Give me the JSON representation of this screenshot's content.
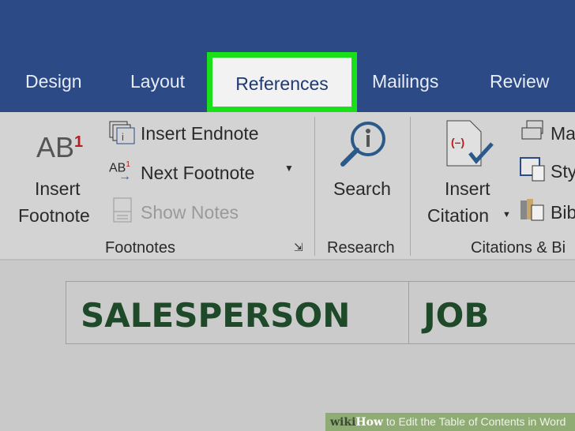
{
  "tabs": {
    "design": "Design",
    "layout": "Layout",
    "references": "References",
    "mailings": "Mailings",
    "review": "Review"
  },
  "highlight_color": "#19e019",
  "footnotes": {
    "insert_footnote_line1": "Insert",
    "insert_footnote_line2": "Footnote",
    "insert_endnote": "Insert Endnote",
    "next_footnote": "Next Footnote",
    "show_notes": "Show Notes",
    "group": "Footnotes",
    "icon_ab": "AB",
    "icon_sup": "1"
  },
  "research": {
    "search": "Search",
    "group": "Research"
  },
  "citations": {
    "insert_citation_line1": "Insert",
    "insert_citation_line2": "Citation",
    "manage": "Ma",
    "style": "Sty",
    "bibliography": "Bib",
    "group": "Citations & Bi"
  },
  "table": {
    "cells": [
      "SALESPERSON",
      "JOB"
    ]
  },
  "watermark": {
    "brand_wiki": "wiki",
    "brand_how": "How",
    "title": " to Edit the Table of Contents in Word"
  }
}
